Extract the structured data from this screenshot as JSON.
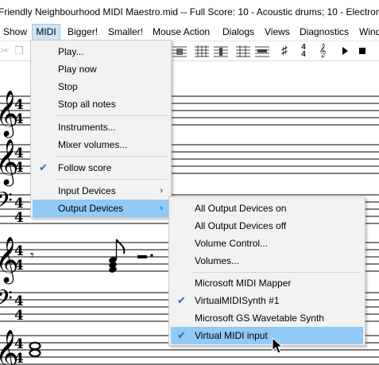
{
  "window": {
    "title": "Friendly Neighbourhood MIDI Maestro.mid -- Full Score: 10 - Acoustic drums; 10 - Electron"
  },
  "menubar": {
    "items": [
      "Show",
      "MIDI",
      "Bigger!",
      "Smaller!",
      "Mouse Action",
      "Dialogs",
      "Views",
      "Diagnostics",
      "Windo"
    ]
  },
  "toolbar": {
    "icons": [
      "scissors-icon",
      "copy-icon",
      "staff-icon",
      "staff-icon",
      "staff-icon",
      "staff-icon",
      "staff-icon",
      "staff-icon",
      "sharp-icon",
      "time-signature-icon",
      "treble-clef-icon",
      "play-icon",
      "stop-icon"
    ]
  },
  "score": {
    "time_signature_top": "4",
    "time_signature_bottom": "4"
  },
  "midi_menu": {
    "items": [
      {
        "label": "Play..."
      },
      {
        "label": "Play now"
      },
      {
        "label": "Stop"
      },
      {
        "label": "Stop all notes"
      },
      {
        "label": "Instruments..."
      },
      {
        "label": "Mixer volumes..."
      },
      {
        "label": "Follow score",
        "checked": true
      },
      {
        "label": "Input Devices",
        "submenu": true
      },
      {
        "label": "Output Devices",
        "submenu": true,
        "highlighted": true
      }
    ]
  },
  "output_menu": {
    "items": [
      {
        "label": "All Output Devices on"
      },
      {
        "label": "All Output Devices off"
      },
      {
        "label": "Volume Control..."
      },
      {
        "label": "Volumes..."
      },
      {
        "label": "Microsoft MIDI Mapper"
      },
      {
        "label": "VirtualMIDISynth #1",
        "checked": true
      },
      {
        "label": "Microsoft GS Wavetable Synth"
      },
      {
        "label": "Virtual MIDI input",
        "checked": true,
        "highlighted": true
      }
    ]
  },
  "glyphs": {
    "check": "✔",
    "submenu_arrow": "›"
  }
}
